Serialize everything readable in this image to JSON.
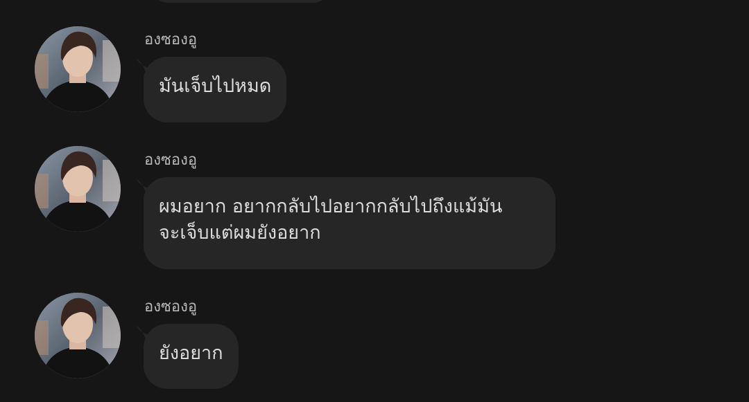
{
  "conversation": {
    "messages": [
      {
        "sender": "องซองอู",
        "text": "มันเจ็บไปหมด",
        "avatar_icon": "person-photo-avatar"
      },
      {
        "sender": "องซองอู",
        "text": "ผมอยาก อยากกลับไปอยากกลับไปถึงแม้มัน\nจะเจ็บแต่ผมยังอยาก",
        "avatar_icon": "person-photo-avatar"
      },
      {
        "sender": "องซองอู",
        "text": "ยังอยาก",
        "avatar_icon": "person-photo-avatar"
      }
    ]
  },
  "colors": {
    "background": "#161616",
    "bubble": "#262626",
    "text": "#dcdcdc",
    "sender": "#b9b9b9"
  }
}
